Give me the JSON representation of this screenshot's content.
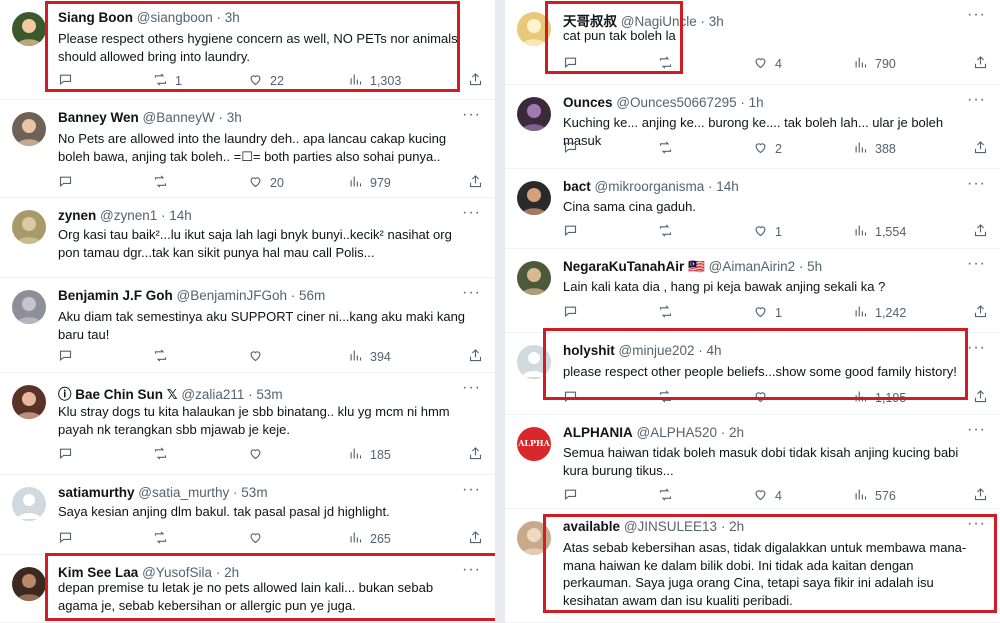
{
  "left": [
    {
      "name": "Siang Boon",
      "handle": "@siangboon",
      "time": "3h",
      "text": "Please respect others hygiene concern as well, NO PETs nor animals should allowed bring into laundry.",
      "replies": "",
      "retweets": "1",
      "likes": "22",
      "views": "1,303"
    },
    {
      "name": "Banney Wen",
      "handle": "@BanneyW",
      "time": "3h",
      "text": "No Pets are allowed into the laundry deh.. apa lancau cakap kucing boleh bawa, anjing tak boleh.. =☐= both parties also sohai punya..",
      "replies": "",
      "retweets": "",
      "likes": "20",
      "views": "979"
    },
    {
      "name": "zynen",
      "handle": "@zynen1",
      "time": "14h",
      "text": "Org kasi tau baik²...lu ikut saja lah lagi bnyk bunyi..kecik² nasihat org pon tamau dgr...tak kan sikit punya hal mau call Polis...",
      "replies": "",
      "retweets": "",
      "likes": "",
      "views": ""
    },
    {
      "name": "Benjamin J.F Goh",
      "handle": "@BenjaminJFGoh",
      "time": "56m",
      "text": "Aku diam tak semestinya aku SUPPORT ciner ni...kang aku maki kang baru tau!",
      "replies": "",
      "retweets": "",
      "likes": "",
      "views": "394"
    },
    {
      "name": "ⓘ Bae Chin Sun 𝕏",
      "handle": "@zalia211",
      "time": "53m",
      "text": "Klu stray dogs tu kita halaukan je sbb binatang.. klu yg mcm ni hmm payah nk terangkan sbb mjawab je keje.",
      "replies": "",
      "retweets": "",
      "likes": "",
      "views": "185"
    },
    {
      "name": "satiamurthy",
      "handle": "@satia_murthy",
      "time": "53m",
      "text": "Saya kesian anjing dlm bakul. tak pasal pasal jd highlight.",
      "replies": "",
      "retweets": "",
      "likes": "",
      "views": "265"
    },
    {
      "name": "Kim See Laa",
      "handle": "@YusofSila",
      "time": "2h",
      "text": "depan premise tu letak je no pets allowed lain kali... bukan sebab agama je, sebab kebersihan or allergic pun ye juga.",
      "replies": "",
      "retweets": "",
      "likes": "",
      "views": ""
    }
  ],
  "right": [
    {
      "name": "天哥叔叔",
      "handle": "@NagiUncle",
      "time": "3h",
      "text": "cat pun tak boleh la",
      "replies": "",
      "retweets": "",
      "likes": "4",
      "views": "790"
    },
    {
      "name": "Ounces",
      "handle": "@Ounces50667295",
      "time": "1h",
      "text": "Kuching ke... anjing ke... burong ke.... tak boleh lah... ular je boleh masuk",
      "replies": "",
      "retweets": "",
      "likes": "2",
      "views": "388"
    },
    {
      "name": "bact",
      "handle": "@mikroorganisma",
      "time": "14h",
      "text": "Cina sama cina gaduh.",
      "replies": "",
      "retweets": "",
      "likes": "1",
      "views": "1,554"
    },
    {
      "name": "NegaraKuTanahAir 🇲🇾",
      "handle": "@AimanAirin2",
      "time": "5h",
      "text": "Lain kali kata dia , hang pi keja bawak anjing sekali ka ?",
      "replies": "",
      "retweets": "",
      "likes": "1",
      "views": "1,242"
    },
    {
      "name": "holyshit",
      "handle": "@minjue202",
      "time": "4h",
      "text": "please respect other people beliefs...show some good family history!",
      "replies": "",
      "retweets": "",
      "likes": "",
      "views": "1,195"
    },
    {
      "name": "ALPHANIA",
      "handle": "@ALPHA520",
      "time": "2h",
      "text": "Semua haiwan tidak boleh masuk dobi tidak kisah anjing kucing babi kura burung tikus...",
      "replies": "",
      "retweets": "",
      "likes": "4",
      "views": "576"
    },
    {
      "name": "available",
      "handle": "@JINSULEE13",
      "time": "2h",
      "text": "Atas sebab kebersihan asas, tidak digalakkan untuk membawa mana-mana haiwan ke dalam bilik dobi. Ini tidak ada kaitan dengan perkauman. Saya juga orang Cina, tetapi saya fikir ini adalah isu kesihatan awam dan isu kualiti peribadi.",
      "replies": "",
      "retweets": "",
      "likes": "",
      "views": ""
    }
  ],
  "avatar_labels": {
    "alphania": "ALPHA"
  },
  "colors": {
    "highlight": "#d01d25",
    "text": "#0f1419",
    "muted": "#536471",
    "divider": "#eff3f4"
  },
  "icons": [
    "reply-icon",
    "retweet-icon",
    "like-icon",
    "views-icon",
    "share-icon",
    "more-icon"
  ]
}
